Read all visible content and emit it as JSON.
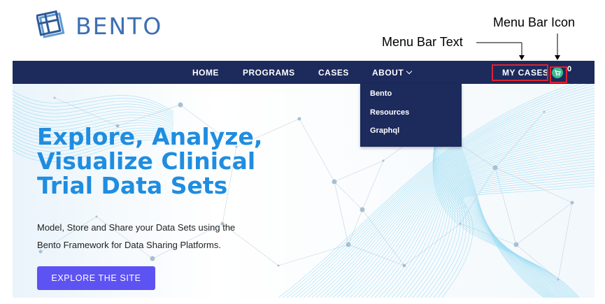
{
  "logo": {
    "text": "BENTO",
    "icon": "bento-logo-icon"
  },
  "annotations": {
    "menu_bar_icon": "Menu Bar Icon",
    "menu_bar_text": "Menu Bar Text"
  },
  "nav": {
    "home": "HOME",
    "programs": "PROGRAMS",
    "cases": "CASES",
    "about": "ABOUT",
    "my_cases": "MY CASES",
    "cart_icon": "cart-icon",
    "cart_count": "0"
  },
  "about_menu": {
    "items": [
      "Bento",
      "Resources",
      "Graphql"
    ]
  },
  "hero": {
    "title_lines": [
      "Explore, Analyze,",
      "Visualize Clinical",
      "Trial Data Sets"
    ],
    "subtitle_lines": [
      "Model, Store and Share your Data Sets using the",
      "Bento Framework for Data Sharing Platforms."
    ],
    "cta": "EXPLORE THE SITE"
  },
  "colors": {
    "navbar": "#1c2a5c",
    "accent": "#1f8de0",
    "cta": "#5d53f3",
    "highlight": "#e0222e",
    "cart": "#3fba8f"
  }
}
